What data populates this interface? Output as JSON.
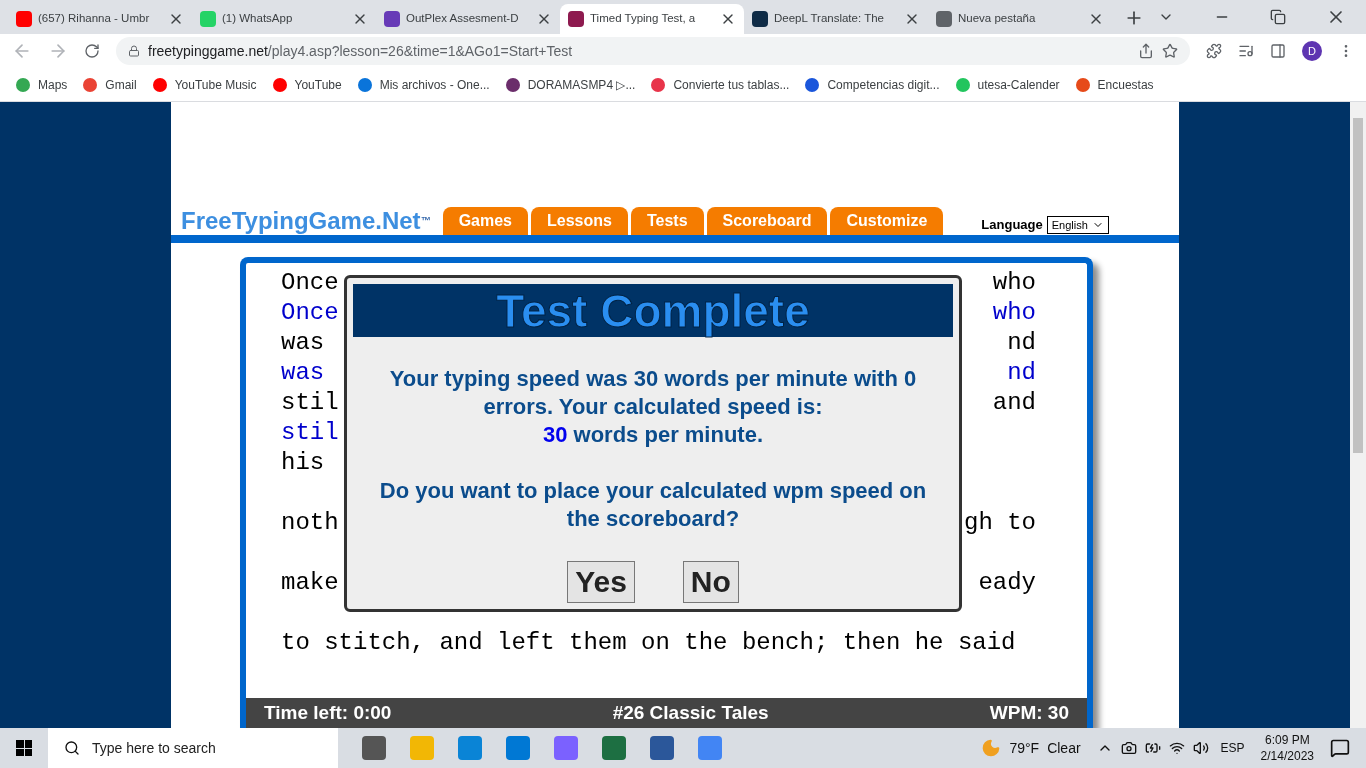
{
  "browser": {
    "tabs": [
      {
        "title": "(657) Rihanna - Umbr",
        "selected": false
      },
      {
        "title": "(1) WhatsApp",
        "selected": false
      },
      {
        "title": "OutPlex Assesment-D",
        "selected": false
      },
      {
        "title": "Timed Typing Test, a",
        "selected": true
      },
      {
        "title": "DeepL Translate: The",
        "selected": false
      },
      {
        "title": "Nueva pestaña",
        "selected": false
      }
    ],
    "url": {
      "host": "freetypinggame.net",
      "path": "/play4.asp?lesson=26&time=1&AGo1=Start+Test"
    },
    "profile": "D",
    "bookmarks": [
      {
        "label": "Maps",
        "color": "#34a853"
      },
      {
        "label": "Gmail",
        "color": "#ea4335"
      },
      {
        "label": "YouTube Music",
        "color": "#ff0000"
      },
      {
        "label": "YouTube",
        "color": "#ff0000"
      },
      {
        "label": "Mis archivos - One...",
        "color": "#0a74da"
      },
      {
        "label": "DORAMASMP4 ▷...",
        "color": "#6b2d6b"
      },
      {
        "label": "Convierte tus tablas...",
        "color": "#e8344a"
      },
      {
        "label": "Competencias digit...",
        "color": "#1a56db"
      },
      {
        "label": "utesa-Calender",
        "color": "#22c55e"
      },
      {
        "label": "Encuestas",
        "color": "#e64a19"
      }
    ]
  },
  "site": {
    "logo": "FreeTypingGame.Net",
    "logo_mark": "™",
    "nav": [
      "Games",
      "Lessons",
      "Tests",
      "Scoreboard",
      "Customize"
    ],
    "language_label": "Language",
    "language_value": "English"
  },
  "typing": {
    "lines": [
      {
        "kind": "source",
        "left": "Once",
        "right": "who"
      },
      {
        "kind": "typed",
        "left": "Once",
        "right": "who"
      },
      {
        "kind": "source",
        "left": "was",
        "right": "nd"
      },
      {
        "kind": "typed",
        "left": "was",
        "right": "nd"
      },
      {
        "kind": "source",
        "left": "stil",
        "right": "and"
      },
      {
        "kind": "typed",
        "left": "stil"
      },
      {
        "kind": "source",
        "left": "his"
      },
      {
        "kind": "blank"
      },
      {
        "kind": "source",
        "left": "noth",
        "right": "gh to"
      },
      {
        "kind": "blank"
      },
      {
        "kind": "source",
        "left": "make",
        "right": "eady"
      },
      {
        "kind": "blank"
      },
      {
        "kind": "source",
        "left": "to stitch, and left them on the bench; then he said"
      }
    ],
    "status": {
      "time_left": "Time left: 0:00",
      "lesson": "#26 Classic Tales",
      "wpm": "WPM: 30"
    }
  },
  "dialog": {
    "title": "Test Complete",
    "message": "Your typing speed was 30 words per minute with 0 errors. Your calculated speed is:",
    "speed": "30",
    "speed_unit": "words per minute.",
    "question": "Do you want to place your calculated wpm speed on the scoreboard?",
    "buttons": [
      "Yes",
      "No"
    ]
  },
  "taskbar": {
    "search_placeholder": "Type here to search",
    "temperature": "79°F",
    "condition": "Clear",
    "language": "ESP",
    "time": "6:09 PM",
    "date": "2/14/2023"
  }
}
